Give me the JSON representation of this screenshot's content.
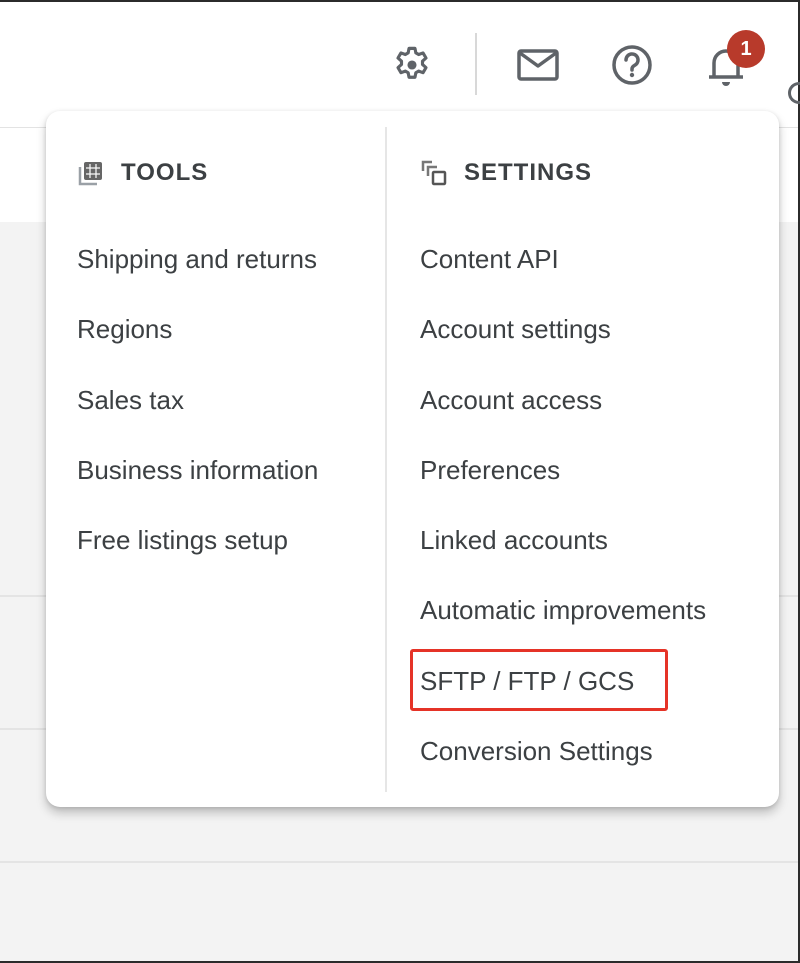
{
  "header": {
    "icons": [
      {
        "name": "settings-gear-icon",
        "label": "Settings"
      },
      {
        "name": "mail-icon",
        "label": "Messages"
      },
      {
        "name": "help-icon",
        "label": "Help"
      },
      {
        "name": "notifications-bell-icon",
        "label": "Notifications"
      }
    ],
    "notification_count": "1",
    "badge_color": "#b83a2b"
  },
  "menu": {
    "tools": {
      "title": "TOOLS",
      "icon": "tools-grid-icon",
      "items": [
        {
          "label": "Shipping and returns"
        },
        {
          "label": "Regions"
        },
        {
          "label": "Sales tax"
        },
        {
          "label": "Business information"
        },
        {
          "label": "Free listings setup"
        }
      ]
    },
    "settings": {
      "title": "SETTINGS",
      "icon": "settings-stack-icon",
      "items": [
        {
          "label": "Content API"
        },
        {
          "label": "Account settings"
        },
        {
          "label": "Account access"
        },
        {
          "label": "Preferences"
        },
        {
          "label": "Linked accounts"
        },
        {
          "label": "Automatic improvements"
        },
        {
          "label": "SFTP / FTP / GCS",
          "highlighted": true
        },
        {
          "label": "Conversion Settings"
        }
      ]
    },
    "highlight_color": "#e53327"
  }
}
